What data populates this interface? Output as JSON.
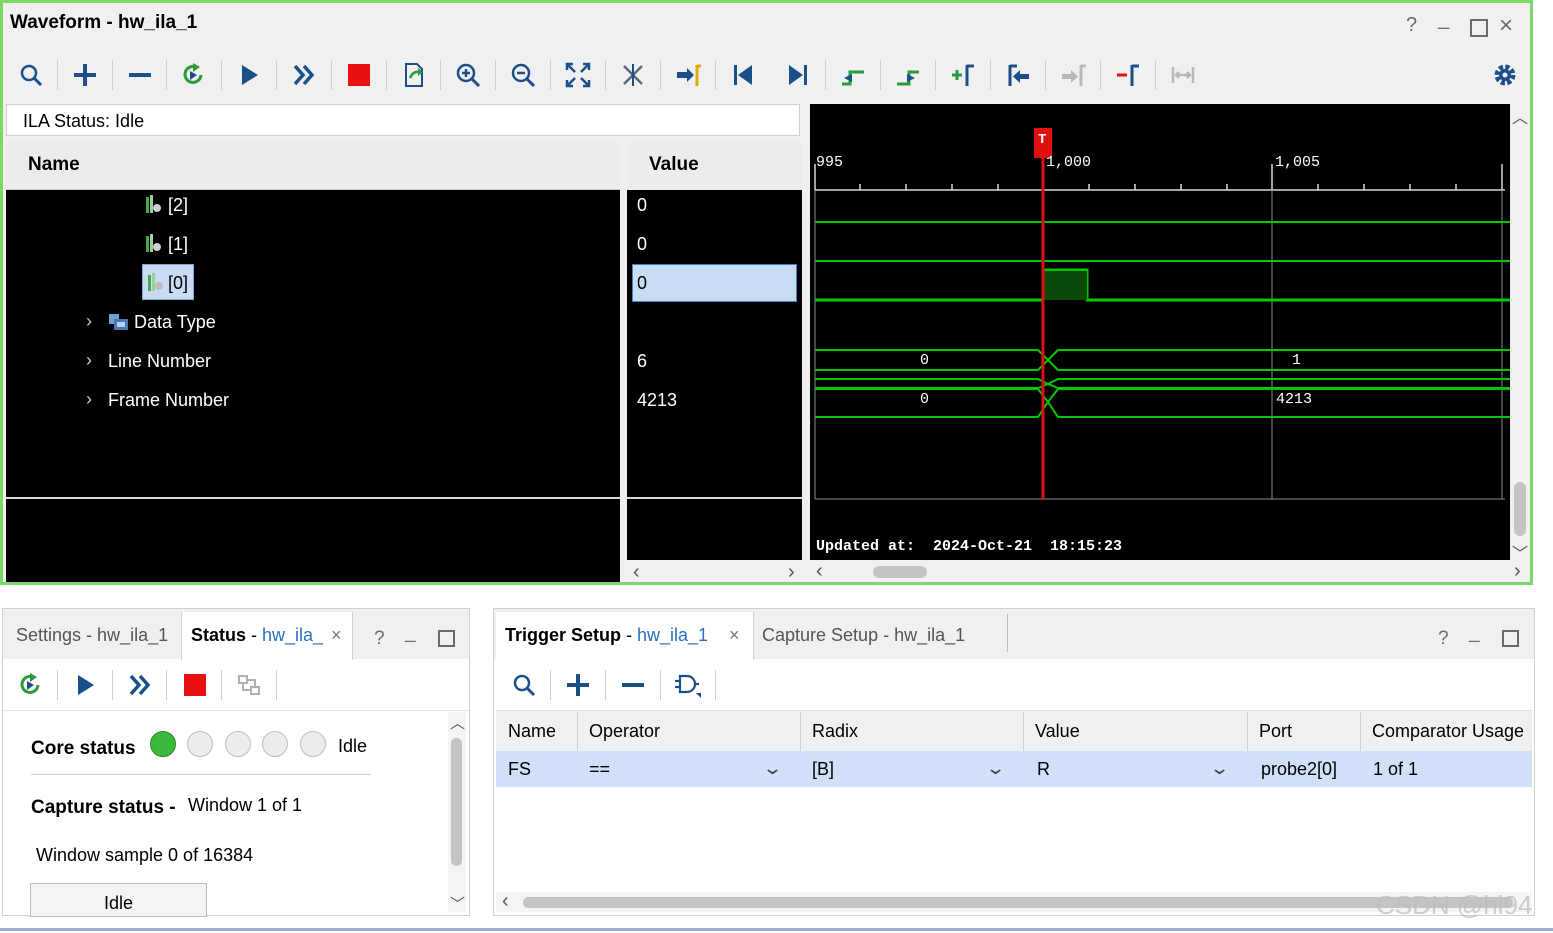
{
  "window": {
    "title": "Waveform - hw_ila_1"
  },
  "toolbar": {
    "icons": [
      "search-icon",
      "add-icon",
      "remove-icon",
      "refresh-run-icon",
      "run-trigger-icon",
      "run-immediate-icon",
      "stop-icon",
      "export-icon",
      "zoom-in-icon",
      "zoom-out-icon",
      "zoom-fit-icon",
      "cursor-remove-icon",
      "goto-cursor-icon",
      "goto-start-icon",
      "goto-end-icon",
      "previous-transition-icon",
      "next-transition-icon",
      "add-marker-icon",
      "previous-marker-icon",
      "next-marker-icon",
      "delete-marker-icon",
      "swap-cursor-icon",
      "settings-gear-icon"
    ]
  },
  "ila_status": "ILA Status:  Idle",
  "columns": {
    "name": "Name",
    "value": "Value"
  },
  "signals": [
    {
      "label": "[2]",
      "value": "0"
    },
    {
      "label": "[1]",
      "value": "0"
    },
    {
      "label": "[0]",
      "value": "0",
      "selected": true
    },
    {
      "label": "Data Type",
      "value": ""
    },
    {
      "label": "Line Number",
      "value": "6"
    },
    {
      "label": "Frame Number",
      "value": "4213"
    }
  ],
  "waveform": {
    "ticks": [
      "995",
      "1,000",
      "1,005"
    ],
    "trigger_marker": "T",
    "bus_line_values": [
      "0",
      "1"
    ],
    "bus_frame_values": [
      "0",
      "4213"
    ],
    "updated_at": "Updated at:  2024-Oct-21  18:15:23",
    "colors": {
      "signal": "#00d000",
      "cursor": "#e01010",
      "background": "#000000"
    }
  },
  "status_panel": {
    "tabs": [
      {
        "title": "Settings",
        "sep": " - ",
        "sub": "hw_ila_1"
      },
      {
        "title": "Status",
        "sep": " - ",
        "sub": "hw_ila_"
      }
    ],
    "core_status_label": "Core status",
    "core_status_value": "Idle",
    "capture_status_label": "Capture status -",
    "capture_status_value": "Window 1 of 1",
    "window_sample": "Window sample 0 of 16384",
    "idle_button": "Idle"
  },
  "trigger_panel": {
    "tabs": [
      {
        "title": "Trigger Setup",
        "sep": " - ",
        "sub": "hw_ila_1"
      },
      {
        "title": "Capture Setup",
        "sep": " - ",
        "sub": "hw_ila_1"
      }
    ],
    "headers": [
      "Name",
      "Operator",
      "Radix",
      "Value",
      "Port",
      "Comparator Usage"
    ],
    "row": {
      "name": "FS",
      "operator": "==",
      "radix": "[B]",
      "value": "R",
      "port": "probe2[0]",
      "usage": "1 of 1"
    }
  },
  "window_controls": {
    "help": "?",
    "minimize": "_",
    "maximize": "□",
    "close": "×"
  },
  "watermark": "CSDN @hi94"
}
